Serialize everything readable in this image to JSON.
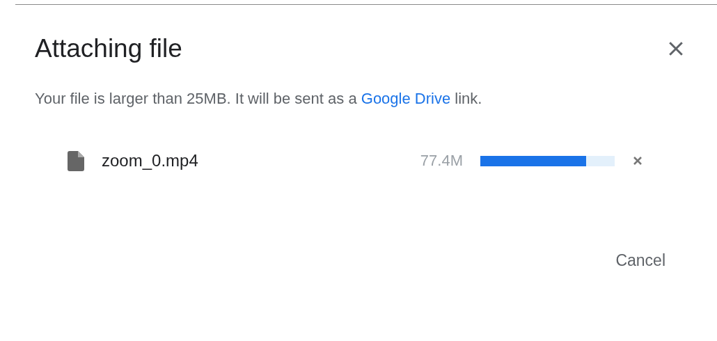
{
  "dialog": {
    "title": "Attaching file",
    "message": "Your file is larger than 25MB. It will be sent as a ",
    "link": "Google Drive",
    "message_end": " link.",
    "files": [
      {
        "name": "zoom_0.mp4",
        "size": "77.4M",
        "level": 0.79
      }
    ],
    "buttons": [
      "Cancel"
    ]
  }
}
